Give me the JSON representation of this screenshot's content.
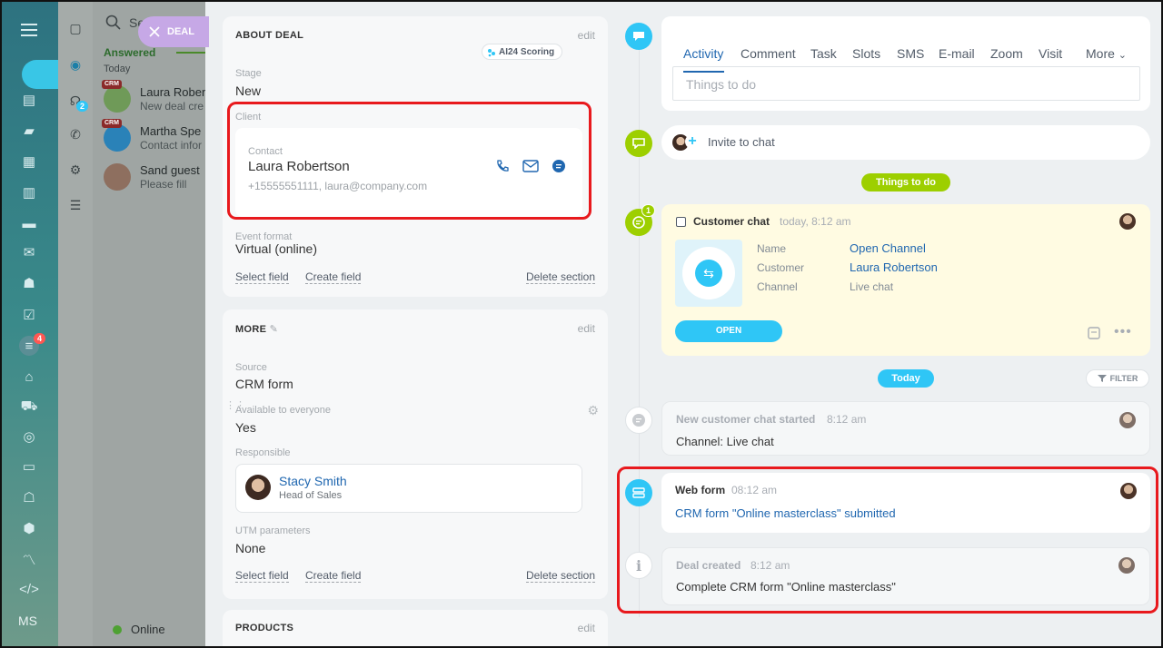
{
  "sidebar": {
    "task_badge": "4",
    "user_initials": "MS"
  },
  "panel2": {
    "notification_badge": "2"
  },
  "chatlist": {
    "search_placeholder": "Se",
    "answered_label": "Answered",
    "today_label": "Today",
    "items": [
      {
        "name": "Laura Rober",
        "subtitle": "New deal cre",
        "tag": "CRM"
      },
      {
        "name": "Martha Spe",
        "subtitle": "Contact infor",
        "tag": "CRM"
      },
      {
        "name": "Sand guest",
        "subtitle": "Please fill"
      }
    ],
    "status": "Online"
  },
  "deal_chip": {
    "label": "DEAL"
  },
  "about": {
    "title": "ABOUT DEAL",
    "ai_badge": "AI24 Scoring",
    "edit": "edit",
    "stage_label": "Stage",
    "stage_value": "New",
    "client_label": "Client",
    "contact_label": "Contact",
    "contact_name": "Laura Robertson",
    "contact_info": "+15555551111, laura@company.com",
    "event_format_label": "Event format",
    "event_format_value": "Virtual (online)",
    "select_field": "Select field",
    "create_field": "Create field",
    "delete_section": "Delete section"
  },
  "more": {
    "title": "MORE",
    "edit": "edit",
    "source_label": "Source",
    "source_value": "CRM form",
    "available_label": "Available to everyone",
    "available_value": "Yes",
    "responsible_label": "Responsible",
    "responsible_name": "Stacy Smith",
    "responsible_role": "Head of Sales",
    "utm_label": "UTM parameters",
    "utm_value": "None",
    "select_field": "Select field",
    "create_field": "Create field",
    "delete_section": "Delete section"
  },
  "products": {
    "title": "PRODUCTS",
    "edit": "edit"
  },
  "activity": {
    "tabs": [
      "Activity",
      "Comment",
      "Task",
      "Slots",
      "SMS",
      "E-mail",
      "Zoom",
      "Visit",
      "More"
    ],
    "placeholder": "Things to do",
    "invite": "Invite to chat",
    "things_to_do_pill": "Things to do",
    "today_pill": "Today",
    "filter": "FILTER"
  },
  "customer_chat": {
    "badge": "1",
    "title": "Customer chat",
    "time": "today, 8:12 am",
    "name_label": "Name",
    "name_value": "Open Channel",
    "customer_label": "Customer",
    "customer_value": "Laura Robertson",
    "channel_label": "Channel",
    "channel_value": "Live chat",
    "open_button": "OPEN"
  },
  "events": {
    "chat_started_title": "New customer chat started",
    "chat_started_time": "8:12 am",
    "chat_started_channel_label": "Channel:",
    "chat_started_channel_value": "Live chat",
    "webform_title": "Web form",
    "webform_time": "08:12 am",
    "webform_link": "CRM form \"Online masterclass\" submitted",
    "deal_created_title": "Deal created",
    "deal_created_time": "8:12 am",
    "deal_created_text": "Complete CRM form \"Online masterclass\""
  },
  "colors": {
    "accent": "#2fc6f6",
    "link": "#2067b0",
    "green": "#9dcf00",
    "highlight": "#e8191d"
  }
}
